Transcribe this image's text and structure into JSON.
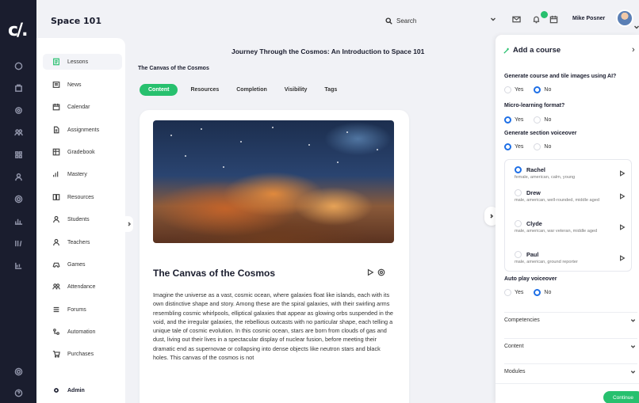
{
  "header": {
    "course_title": "Space 101",
    "search_placeholder": "Search",
    "user_name": "Mike Posner"
  },
  "subnav": {
    "items": [
      {
        "label": "Lessons",
        "icon": "lessons-icon",
        "active": true
      },
      {
        "label": "News",
        "icon": "news-icon"
      },
      {
        "label": "Calendar",
        "icon": "calendar-icon"
      },
      {
        "label": "Assignments",
        "icon": "assignments-icon"
      },
      {
        "label": "Gradebook",
        "icon": "gradebook-icon"
      },
      {
        "label": "Mastery",
        "icon": "mastery-icon"
      },
      {
        "label": "Resources",
        "icon": "resources-icon"
      },
      {
        "label": "Students",
        "icon": "students-icon"
      },
      {
        "label": "Teachers",
        "icon": "teachers-icon"
      },
      {
        "label": "Games",
        "icon": "games-icon"
      },
      {
        "label": "Attendance",
        "icon": "attendance-icon"
      },
      {
        "label": "Forums",
        "icon": "forums-icon"
      },
      {
        "label": "Automation",
        "icon": "automation-icon"
      },
      {
        "label": "Purchases",
        "icon": "purchases-icon"
      }
    ],
    "admin_label": "Admin"
  },
  "main": {
    "heading": "Journey Through the Cosmos: An Introduction to Space 101",
    "lesson_title": "The Canvas of the Cosmos",
    "tabs": [
      "Content",
      "Resources",
      "Completion",
      "Visibility",
      "Tags"
    ],
    "active_tab": "Content",
    "card": {
      "title": "The Canvas of the Cosmos",
      "body": "Imagine the universe as a vast, cosmic ocean, where galaxies float like islands, each with its own distinctive shape and story. Among these are the spiral galaxies, with their swirling arms resembling cosmic whirlpools, elliptical galaxies that appear as glowing orbs suspended in the void, and the irregular galaxies, the rebellious outcasts with no particular shape, each telling a unique tale of cosmic evolution. In this cosmic ocean, stars are born from clouds of gas and dust, living out their lives in a spectacular display of nuclear fusion, before meeting their dramatic end as supernovae or collapsing into dense objects like neutron stars and black holes. This canvas of the cosmos is not"
    }
  },
  "panel": {
    "title": "Add a course",
    "q_images": "Generate course and tile images using AI?",
    "q_micro": "Micro-learning format?",
    "q_voiceover": "Generate section voiceover",
    "q_autoplay": "Auto play voiceover",
    "yes": "Yes",
    "no": "No",
    "voices": [
      {
        "name": "Rachel",
        "desc": "female, american, calm, young",
        "selected": true
      },
      {
        "name": "Drew",
        "desc": "male, american, well-rounded, middle aged"
      },
      {
        "name": "Clyde",
        "desc": "male, american, war veteran, middle aged"
      },
      {
        "name": "Paul",
        "desc": "male, american, ground reporter"
      }
    ],
    "accordions": [
      "Competencies",
      "Content",
      "Modules"
    ],
    "continue_label": "Continue"
  },
  "colors": {
    "accent": "#27c06e",
    "radio": "#1e6fe6",
    "rail": "#1a1d2e"
  }
}
